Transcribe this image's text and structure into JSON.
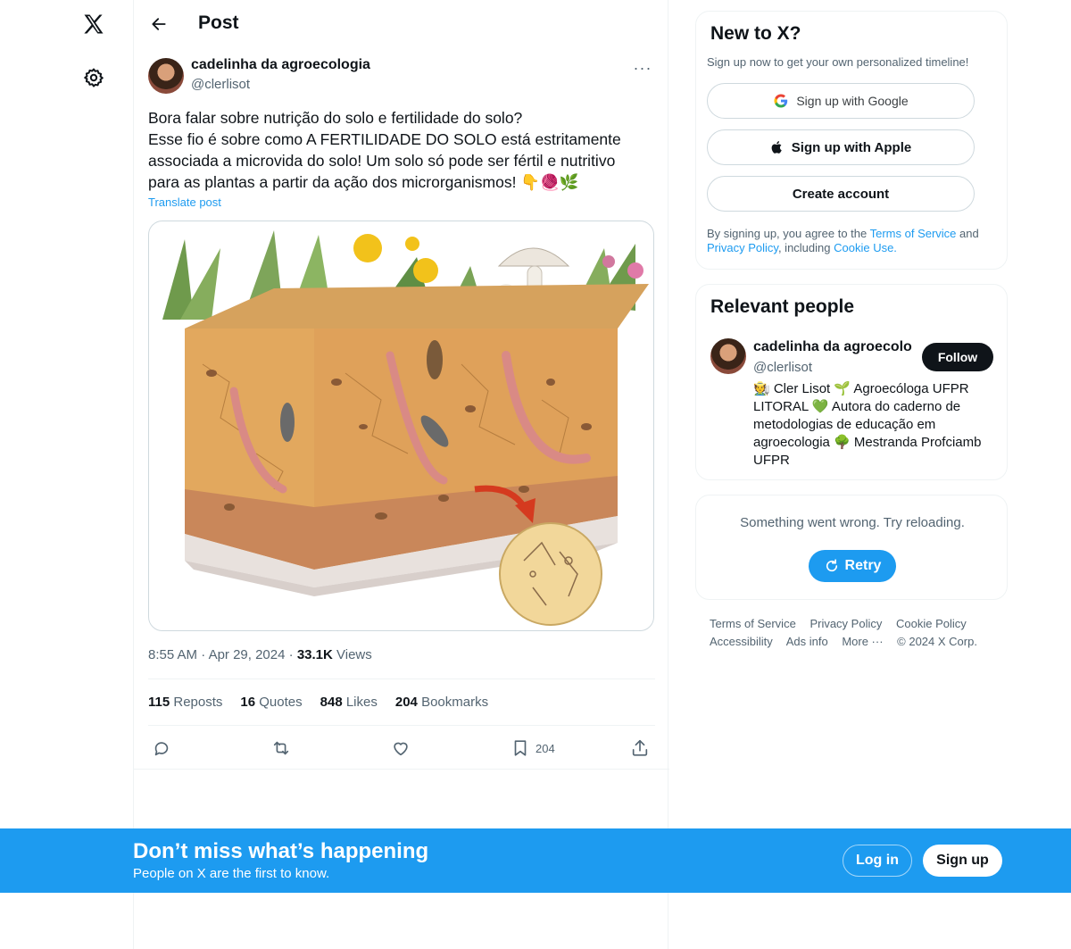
{
  "nav": {
    "logo_icon": "x-logo-icon",
    "settings_icon": "gear-icon"
  },
  "header": {
    "title": "Post",
    "back_icon": "arrow-left-icon"
  },
  "post": {
    "author_name": "cadelinha da agroecologia",
    "author_handle": "@clerlisot",
    "more_label": "···",
    "text_lines": [
      "Bora falar sobre nutrição do solo e fertilidade do solo?",
      "Esse fio é sobre como A FERTILIDADE DO SOLO está estritamente associada a microvida do solo! Um solo só pode ser fértil e nutritivo para as plantas a partir da ação dos microrganismos! 👇🧶🌿"
    ],
    "translate_label": "Translate post",
    "time": "8:55 AM",
    "date": "Apr 29, 2024",
    "views_count": "33.1K",
    "views_label": "Views",
    "stats": [
      {
        "count": "115",
        "label": "Reposts"
      },
      {
        "count": "16",
        "label": "Quotes"
      },
      {
        "count": "848",
        "label": "Likes"
      },
      {
        "count": "204",
        "label": "Bookmarks"
      }
    ],
    "bookmark_count": "204"
  },
  "signup_card": {
    "title": "New to X?",
    "subtitle": "Sign up now to get your own personalized timeline!",
    "google_label": "Sign up with Google",
    "apple_label": "Sign up with Apple",
    "create_label": "Create account",
    "legal_prefix": "By signing up, you agree to the ",
    "terms_label": "Terms of Service",
    "legal_and": " and ",
    "privacy_label": "Privacy Policy",
    "legal_including": ", including ",
    "cookie_label": "Cookie Use."
  },
  "people": {
    "title": "Relevant people",
    "name": "cadelinha da agroecologia",
    "handle": "@clerlisot",
    "follow_label": "Follow",
    "bio": "🧑‍🌾 Cler Lisot 🌱 Agroecóloga UFPR LITORAL 💚 Autora do caderno de metodologias de educação em agroecologia 🌳 Mestranda Profciamb UFPR"
  },
  "error": {
    "text": "Something went wrong. Try reloading.",
    "retry_label": "Retry"
  },
  "footer": {
    "links": [
      "Terms of Service",
      "Privacy Policy",
      "Cookie Policy",
      "Accessibility",
      "Ads info",
      "More ···",
      "© 2024 X Corp."
    ]
  },
  "bottom_bar": {
    "title": "Don’t miss what’s happening",
    "subtitle": "People on X are the first to know.",
    "login_label": "Log in",
    "signup_label": "Sign up"
  },
  "colors": {
    "accent": "#1d9bf0",
    "text": "#0f1419",
    "muted": "#536471"
  }
}
